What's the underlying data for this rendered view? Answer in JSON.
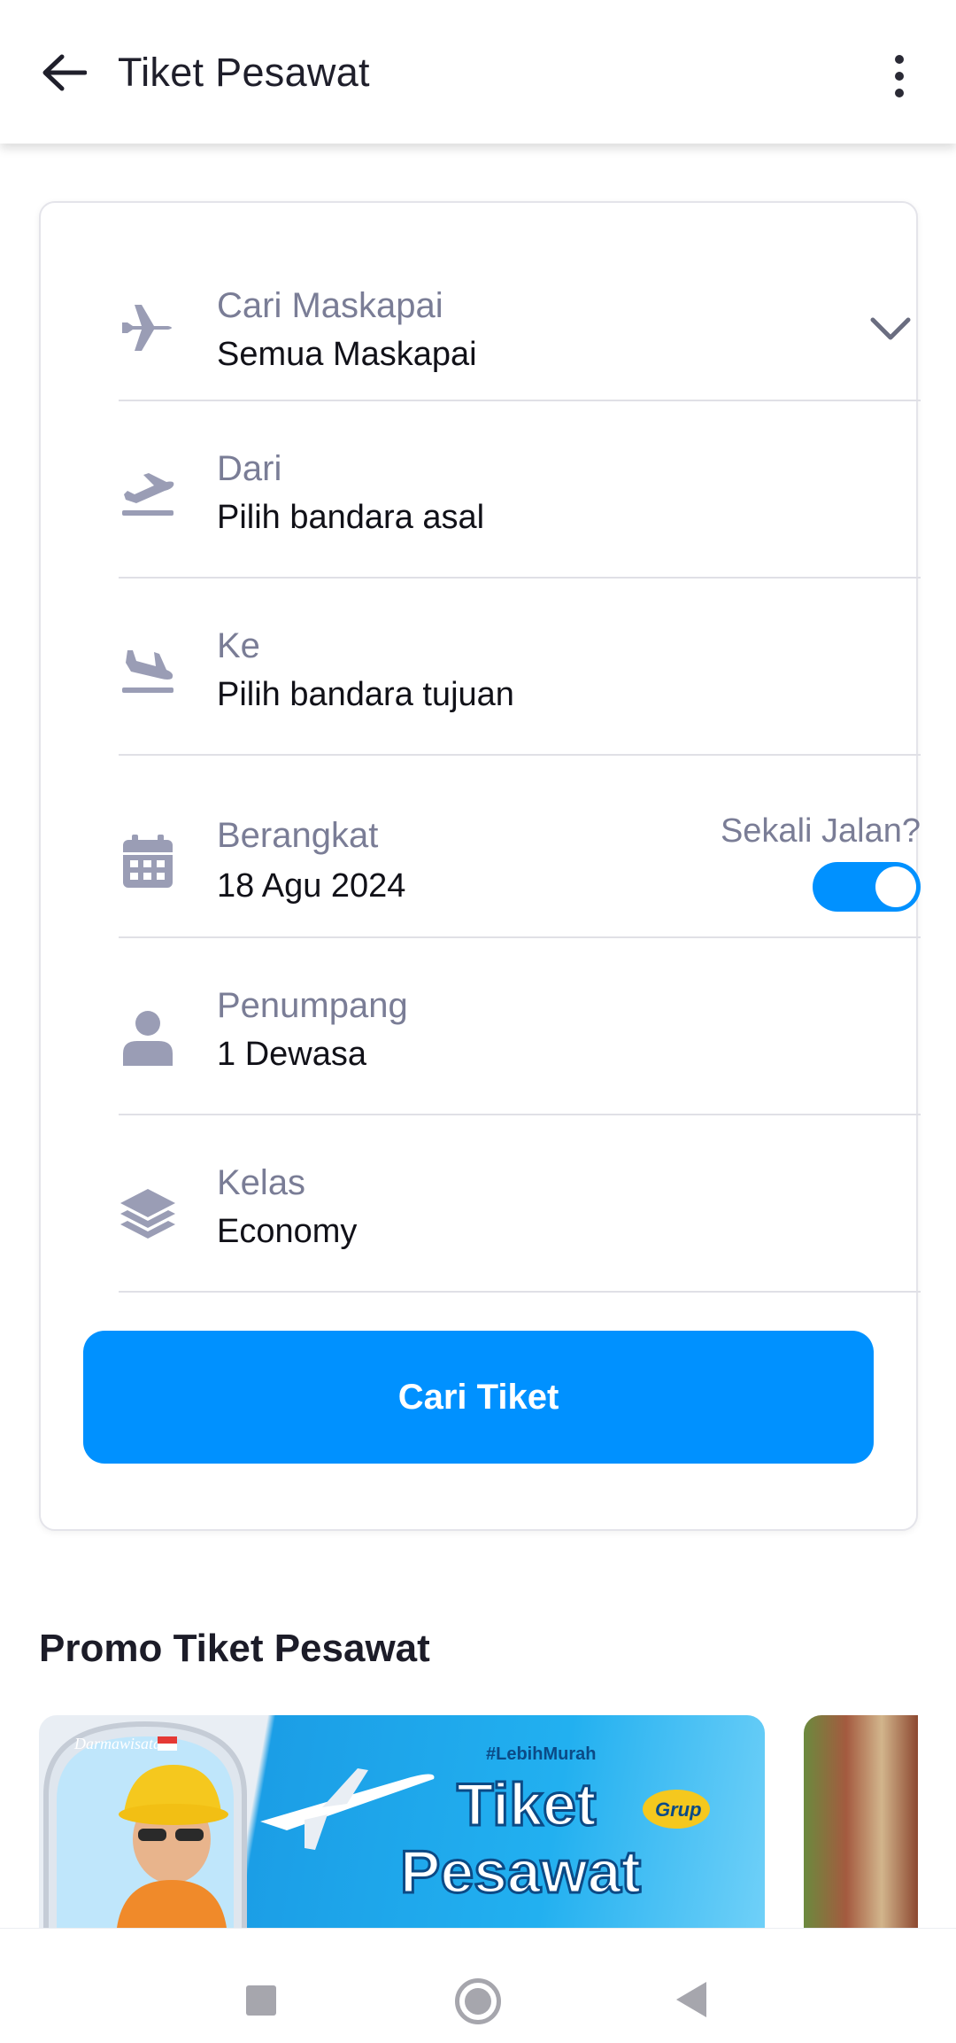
{
  "appbar": {
    "title": "Tiket Pesawat"
  },
  "form": {
    "airline": {
      "label": "Cari Maskapai",
      "value": "Semua Maskapai",
      "icon": "airplane-icon"
    },
    "from": {
      "label": "Dari",
      "value": "Pilih bandara asal",
      "icon": "takeoff-icon"
    },
    "to": {
      "label": "Ke",
      "value": "Pilih bandara tujuan",
      "icon": "landing-icon"
    },
    "depart": {
      "label": "Berangkat",
      "value": "18 Agu 2024",
      "icon": "calendar-icon"
    },
    "oneway": {
      "label": "Sekali Jalan?",
      "enabled": true
    },
    "passenger": {
      "label": "Penumpang",
      "value": "1 Dewasa",
      "icon": "person-icon"
    },
    "class": {
      "label": "Kelas",
      "value": "Economy",
      "icon": "layers-icon"
    },
    "search_label": "Cari Tiket"
  },
  "promo": {
    "title": "Promo Tiket Pesawat"
  },
  "colors": {
    "accent": "#0091ff",
    "icon": "#9a9db5",
    "label": "#7a7d96"
  }
}
